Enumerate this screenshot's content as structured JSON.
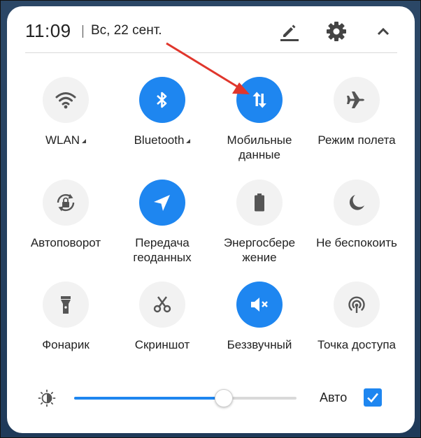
{
  "status": {
    "time": "11:09",
    "date": "Вс, 22 сент."
  },
  "header_icons": [
    "edit-icon",
    "gear-icon",
    "chevron-up-icon"
  ],
  "tiles": [
    {
      "label": "WLAN",
      "icon": "wifi-icon",
      "active": false,
      "expandable": true
    },
    {
      "label": "Bluetooth",
      "icon": "bluetooth-icon",
      "active": true,
      "expandable": true
    },
    {
      "label": "Мобильные данные",
      "icon": "mobile-data-icon",
      "active": true,
      "expandable": false
    },
    {
      "label": "Режим полета",
      "icon": "airplane-icon",
      "active": false,
      "expandable": false
    },
    {
      "label": "Автоповорот",
      "icon": "rotation-lock-icon",
      "active": false,
      "expandable": false
    },
    {
      "label": "Передача геоданных",
      "icon": "location-icon",
      "active": true,
      "expandable": false
    },
    {
      "label": "Энергосбере жение",
      "icon": "battery-icon",
      "active": false,
      "expandable": false
    },
    {
      "label": "Не беспокоить",
      "icon": "moon-icon",
      "active": false,
      "expandable": false
    },
    {
      "label": "Фонарик",
      "icon": "flashlight-icon",
      "active": false,
      "expandable": false
    },
    {
      "label": "Скриншот",
      "icon": "scissors-icon",
      "active": false,
      "expandable": false
    },
    {
      "label": "Беззвучный",
      "icon": "mute-icon",
      "active": true,
      "expandable": false
    },
    {
      "label": "Точка доступа",
      "icon": "hotspot-icon",
      "active": false,
      "expandable": false
    }
  ],
  "brightness": {
    "level_fraction": 0.67,
    "auto_label": "Авто",
    "auto_checked": true
  },
  "colors": {
    "accent": "#1e86f0",
    "tile_off": "#f2f2f2",
    "arrow": "#e0362c"
  }
}
